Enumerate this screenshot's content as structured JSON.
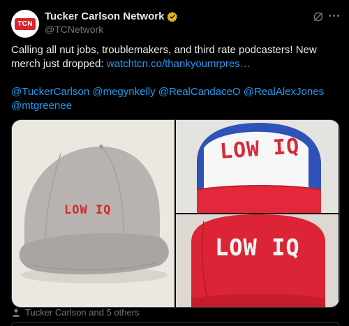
{
  "author": {
    "name": "Tucker Carlson Network",
    "handle": "@TCNetwork",
    "logo_text": "TCN"
  },
  "tweet": {
    "text_part1": "Calling all nut jobs, troublemakers, and third rate podcasters! New merch just dropped: ",
    "link": "watchtcn.co/thankyoumrpres…",
    "mentions_line1": "@TuckerCarlson @megynkelly @RealCandaceO @RealAlexJones",
    "mentions_line2": "@mtgreenee"
  },
  "media": {
    "hat_text_1": "LOW IQ",
    "hat_text_2": "LOW IQ",
    "hat_text_3": "LOW IQ"
  },
  "tagged": "Tucker Carlson and 5 others",
  "colors": {
    "accent": "#1d9bf0",
    "verified_gold": "#e2b719",
    "logo_red": "#d8262b"
  }
}
